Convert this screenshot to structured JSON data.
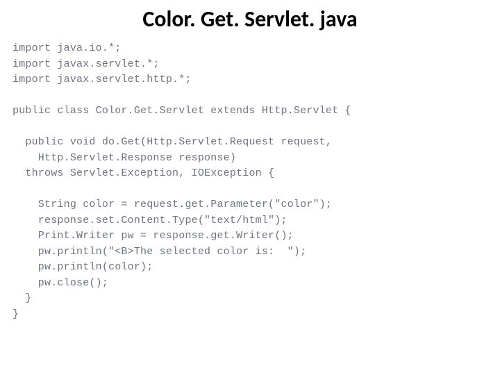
{
  "title": "Color. Get. Servlet. java",
  "code": {
    "l01": "import java.io.*;",
    "l02": "import javax.servlet.*;",
    "l03": "import javax.servlet.http.*;",
    "l04": "",
    "l05": "public class Color.Get.Servlet extends Http.Servlet {",
    "l06": "",
    "l07": "  public void do.Get(Http.Servlet.Request request,",
    "l08": "    Http.Servlet.Response response)",
    "l09": "  throws Servlet.Exception, IOException {",
    "l10": "",
    "l11": "    String color = request.get.Parameter(\"color\");",
    "l12": "    response.set.Content.Type(\"text/html\");",
    "l13": "    Print.Writer pw = response.get.Writer();",
    "l14": "    pw.println(\"<B>The selected color is:  \");",
    "l15": "    pw.println(color);",
    "l16": "    pw.close();",
    "l17": "  }",
    "l18": "}"
  }
}
